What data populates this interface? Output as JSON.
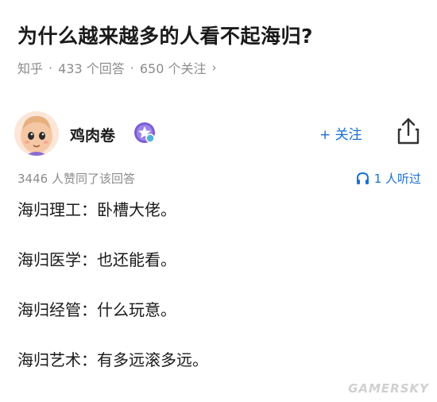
{
  "question": {
    "title": "为什么越来越多的人看不起海归?",
    "source": "知乎",
    "answers": "433 个回答",
    "followers": "650 个关注",
    "separator": "·",
    "chevron": "›"
  },
  "author": {
    "name": "鸡肉卷",
    "avatar_icon": "cartoon-avatar",
    "badge_icon": "purple-star-badge-icon",
    "follow_label": "+ 关注",
    "share_icon": "share-icon"
  },
  "stats": {
    "likes": "3446 人赞同了该回答",
    "listeners": "1 人听过",
    "listen_icon": "headphones-icon"
  },
  "answer": {
    "lines": [
      "海归理工：卧槽大佬。",
      "海归医学：也还能看。",
      "海归经管：什么玩意。",
      "海归艺术：有多远滚多远。"
    ]
  },
  "watermark": "GAMERSKY",
  "colors": {
    "accent": "#1b6fd4",
    "muted": "#8c8c8c",
    "text": "#1a1a1a"
  }
}
